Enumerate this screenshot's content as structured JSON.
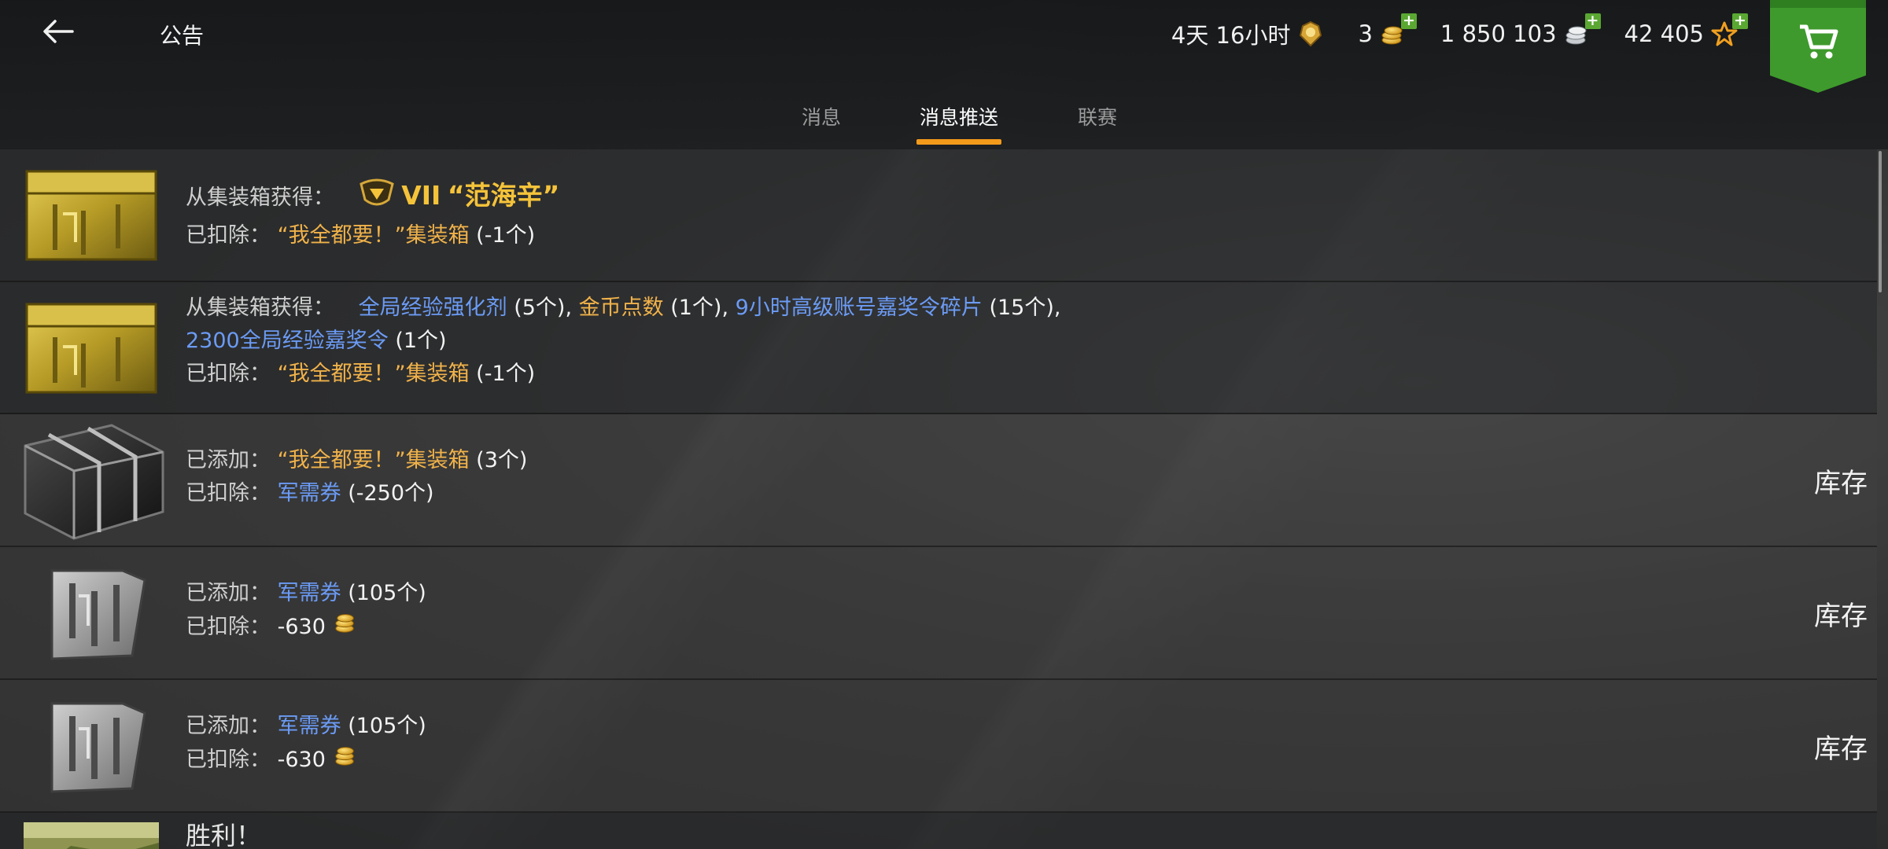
{
  "header": {
    "title": "公告",
    "back_icon": "back-arrow-icon",
    "resources": [
      {
        "value": "4天 16小时",
        "icon": "premium-badge-icon",
        "has_plus": false
      },
      {
        "value": "3",
        "icon": "gold-coins-icon",
        "has_plus": true
      },
      {
        "value": "1 850 103",
        "icon": "silver-coins-icon",
        "has_plus": true
      },
      {
        "value": "42 405",
        "icon": "free-xp-star-icon",
        "has_plus": true
      }
    ],
    "shop_icon": "cart-icon"
  },
  "tabs": [
    {
      "label": "消息",
      "active": false
    },
    {
      "label": "消息推送",
      "active": true
    },
    {
      "label": "联赛",
      "active": false
    }
  ],
  "messages": [
    {
      "thumb": "gold-crate",
      "line1_label": "从集装箱获得：",
      "line1_tier": "VII",
      "line1_name": "“范海辛”",
      "line2_label": "已扣除：",
      "line2_item": "“我全都要！”集装箱",
      "line2_qty": "(-1个)"
    },
    {
      "thumb": "gold-crate",
      "label": "从集装箱获得：",
      "items": [
        {
          "name": "全局经验强化剂",
          "qty": "(5个)",
          "color": "blue",
          "sep": ","
        },
        {
          "name": "金币点数",
          "qty": "(1个)",
          "color": "orange",
          "sep": ","
        },
        {
          "name": "9小时高级账号嘉奖令碎片",
          "qty": "(15个)",
          "color": "blue",
          "sep": ","
        },
        {
          "name": "2300全局经验嘉奖令",
          "qty": "(1个)",
          "color": "blue",
          "sep": ""
        }
      ],
      "line3_label": "已扣除：",
      "line3_item": "“我全都要！”集装箱",
      "line3_qty": "(-1个)"
    },
    {
      "thumb": "black-crate",
      "line1_label": "已添加：",
      "line1_item": "“我全都要！”集装箱",
      "line1_qty": "(3个)",
      "line2_label": "已扣除：",
      "line2_item": "军需券",
      "line2_qty": "(-250个)",
      "action": "库存"
    },
    {
      "thumb": "ticket",
      "line1_label": "已添加：",
      "line1_item": "军需券",
      "line1_qty": "(105个)",
      "line2_label": "已扣除：",
      "line2_value": "-630",
      "action": "库存"
    },
    {
      "thumb": "ticket",
      "line1_label": "已添加：",
      "line1_item": "军需券",
      "line1_qty": "(105个)",
      "line2_label": "已扣除：",
      "line2_value": "-630",
      "action": "库存"
    },
    {
      "thumb": "battle-image",
      "title": "胜利！"
    }
  ],
  "colors": {
    "accent_tab": "#f39a1a",
    "orange_item": "#f0b24a",
    "blue_item": "#6b9bf5",
    "gold_tank": "#f5c33a",
    "shop_green": "#3e9a2c"
  }
}
